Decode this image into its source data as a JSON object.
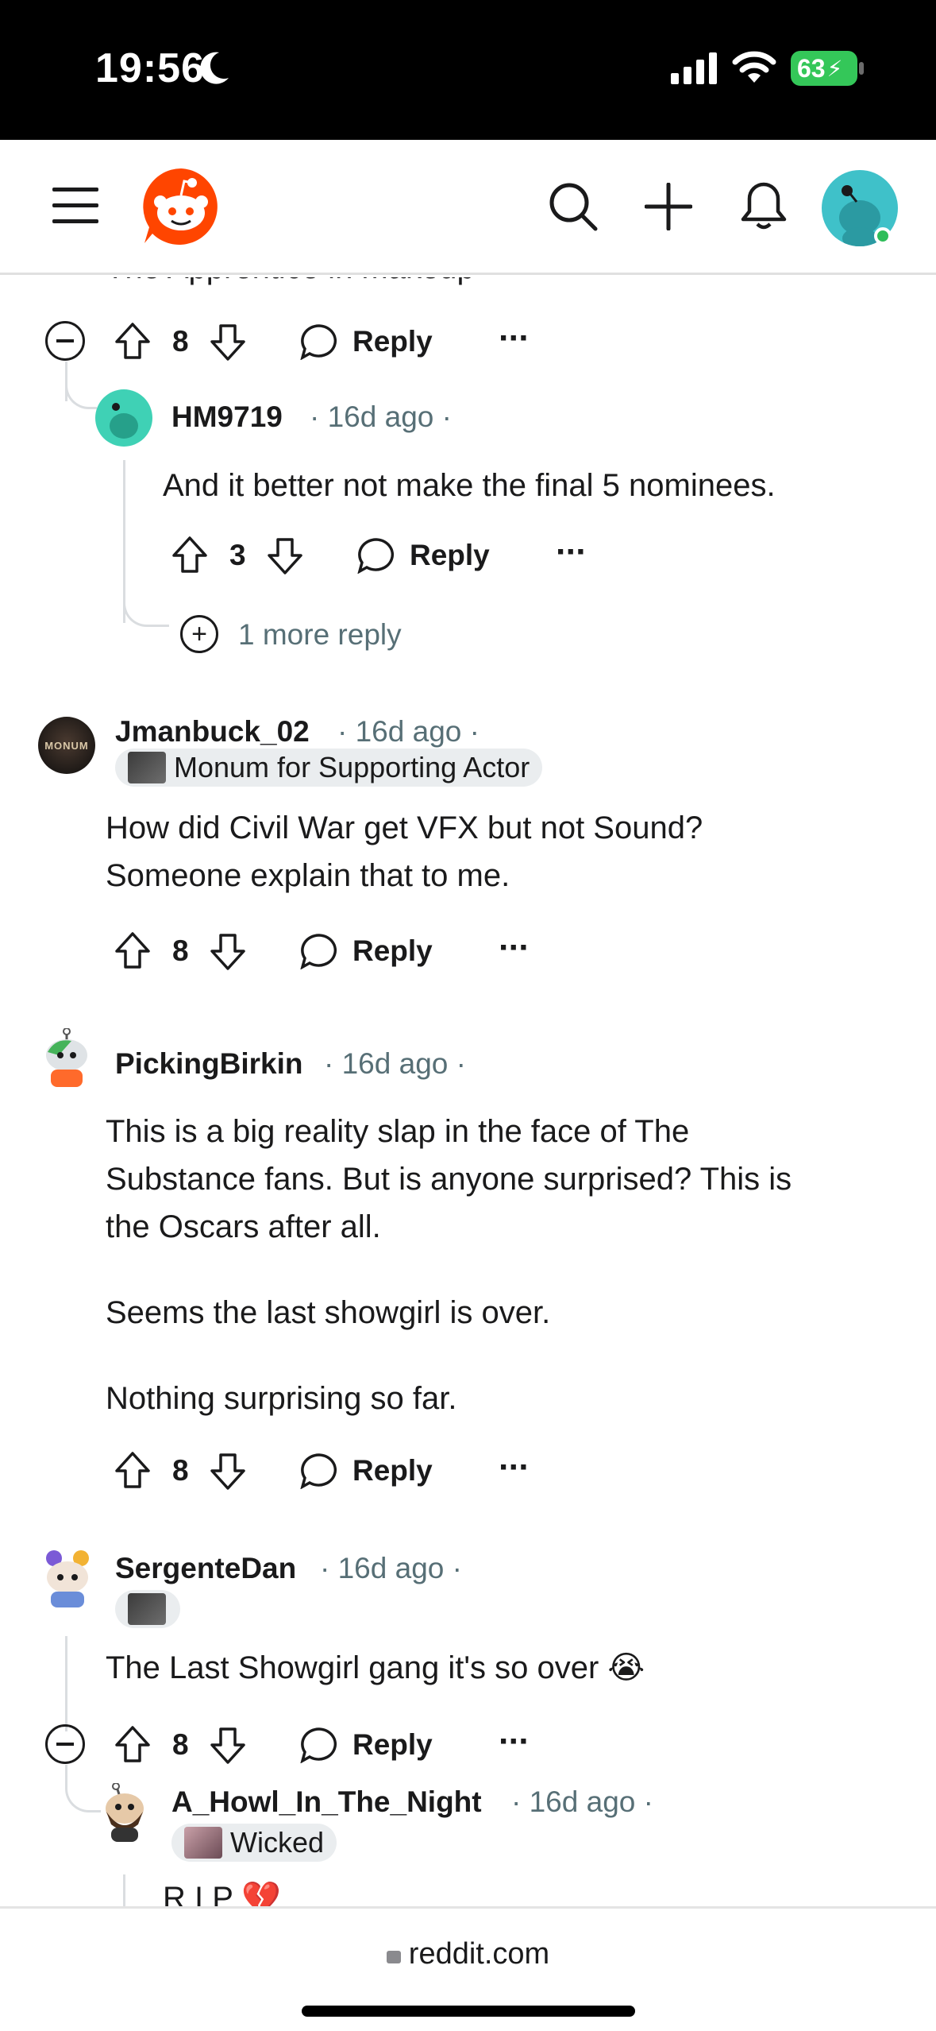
{
  "status_bar": {
    "time": "19:56",
    "battery": "63"
  },
  "app_bar": {
    "icons": [
      "menu-icon",
      "reddit-logo",
      "search-icon",
      "create-icon",
      "notifications-icon",
      "avatar"
    ]
  },
  "partial_prev_text": "The Apprentice in makeup",
  "comments": [
    {
      "id": "c0",
      "votes": "8",
      "reply_label": "Reply"
    },
    {
      "id": "c1",
      "username": "HM9719",
      "age": "16d ago",
      "body": "And it better not make the final 5 nominees.",
      "votes": "3",
      "reply_label": "Reply",
      "more_replies": "1 more reply"
    },
    {
      "id": "c2",
      "username": "Jmanbuck_02",
      "age": "16d ago",
      "flair": "Monum for Supporting Actor",
      "avatar_text": "MONUM",
      "body_lines": [
        "How did Civil War get VFX but not Sound?",
        "Someone explain that to me."
      ],
      "votes": "8",
      "reply_label": "Reply"
    },
    {
      "id": "c3",
      "username": "PickingBirkin",
      "age": "16d ago",
      "body_p1": [
        "This is a big reality slap in the face of The",
        "Substance fans. But is anyone surprised? This is",
        "the Oscars after all."
      ],
      "body_p2": "Seems the last showgirl is over.",
      "body_p3": "Nothing surprising so far.",
      "votes": "8",
      "reply_label": "Reply"
    },
    {
      "id": "c4",
      "username": "SergenteDan",
      "age": "16d ago",
      "body": "The Last Showgirl gang it's so over 😭",
      "votes": "8",
      "reply_label": "Reply"
    },
    {
      "id": "c5",
      "username": "A_Howl_In_The_Night",
      "age": "16d ago",
      "flair": "Wicked",
      "body_partial": "R I P 💔"
    }
  ],
  "bottom": {
    "url": "reddit.com"
  },
  "colors": {
    "brand": "#ff4500",
    "accent_teal": "#3fc1c9",
    "online": "#2ebd59",
    "meta": "#576f76"
  }
}
